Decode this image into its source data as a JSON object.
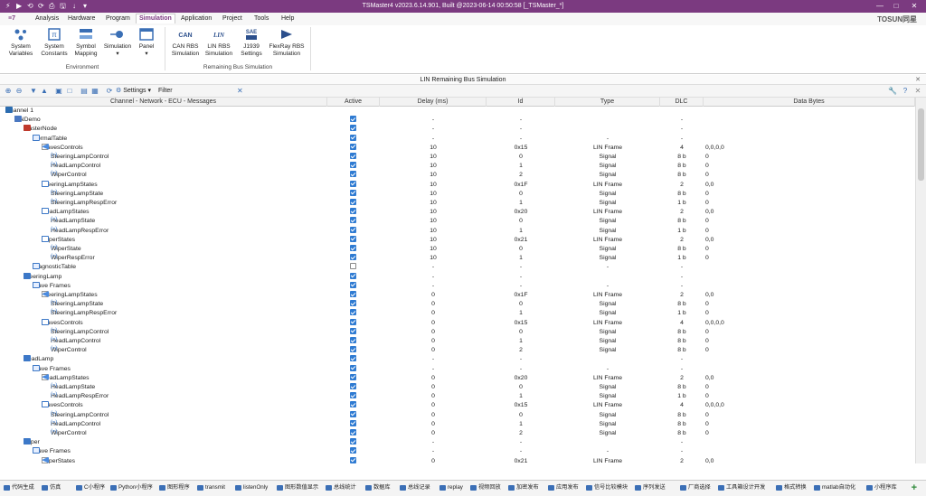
{
  "titlebar": {
    "title": "TSMaster4 v2023.6.14.901, Built @2023-06-14 00:50:58 [_TSMaster_*]",
    "min": "—",
    "max": "□",
    "close": "✕",
    "qa": [
      "⚡",
      "▶",
      "⟲",
      "⟳",
      "⎙",
      "🖫",
      "↓",
      "▾"
    ]
  },
  "menu": {
    "logo": "≡7",
    "items": [
      "Analysis",
      "Hardware",
      "Program",
      "Simulation",
      "Application",
      "Project",
      "Tools",
      "Help"
    ],
    "active": "Simulation",
    "brand": "TOSUN同星"
  },
  "ribbon": {
    "buttons": [
      {
        "label": "System\nVariables",
        "icon": "system-variables-icon"
      },
      {
        "label": "System\nConstants",
        "icon": "system-constants-icon"
      },
      {
        "label": "Symbol\nMapping",
        "icon": "symbol-mapping-icon"
      },
      {
        "label": "Simulation\n▾",
        "icon": "simulation-icon"
      },
      {
        "label": "Panel\n▾",
        "icon": "panel-icon"
      },
      {
        "label": "CAN RBS\nSimulation",
        "icon": "can-rbs-icon",
        "badge": "CAN"
      },
      {
        "label": "LIN RBS\nSimulation",
        "icon": "lin-rbs-icon",
        "badge": "LIN"
      },
      {
        "label": "J1939\nSettings",
        "icon": "j1939-icon",
        "badge": "SAE"
      },
      {
        "label": "FlexRay RBS\nSimulation",
        "icon": "flexray-rbs-icon",
        "badge": "FR"
      }
    ],
    "groups": [
      "Environment",
      "Remaining Bus Simulation"
    ]
  },
  "pane": {
    "title": "LIN Remaining Bus Simulation",
    "close": "✕"
  },
  "toolbar": {
    "settings": "Settings",
    "filter": "Filter",
    "filter_value": "",
    "clear": "✕"
  },
  "columns": [
    "Channel - Network - ECU - Messages",
    "Active",
    "Delay (ms)",
    "Id",
    "Type",
    "DLC",
    "Data Bytes"
  ],
  "rows": [
    {
      "d": 0,
      "exp": "□",
      "ico": "ch",
      "name": "Channel 1",
      "active": null,
      "delay": "",
      "id": "",
      "type": "",
      "dlc": "",
      "data": ""
    },
    {
      "d": 1,
      "exp": "−",
      "ico": "db",
      "name": "LINDemo",
      "active": true,
      "delay": "-",
      "id": "-",
      "type": "",
      "dlc": "-",
      "data": ""
    },
    {
      "d": 2,
      "exp": "−",
      "ico": "node-m",
      "name": "MasterNode",
      "active": true,
      "delay": "-",
      "id": "-",
      "type": "",
      "dlc": "-",
      "data": ""
    },
    {
      "d": 3,
      "exp": "−",
      "ico": "table",
      "name": "NormalTable",
      "active": true,
      "delay": "-",
      "id": "-",
      "type": "-",
      "dlc": "-",
      "data": ""
    },
    {
      "d": 4,
      "exp": "−",
      "ico": "frame",
      "name": "SlavesControls",
      "active": true,
      "delay": "10",
      "id": "0x15",
      "type": "LIN Frame",
      "dlc": "4",
      "data": "0,0,0,0"
    },
    {
      "d": 5,
      "exp": "",
      "ico": "sig",
      "name": "SteeringLampControl",
      "active": true,
      "delay": "10",
      "id": "0",
      "type": "Signal",
      "dlc": "8 b",
      "data": "0"
    },
    {
      "d": 5,
      "exp": "",
      "ico": "sig",
      "name": "HeadLampControl",
      "active": true,
      "delay": "10",
      "id": "1",
      "type": "Signal",
      "dlc": "8 b",
      "data": "0"
    },
    {
      "d": 5,
      "exp": "",
      "ico": "sig",
      "name": "WiperControl",
      "active": true,
      "delay": "10",
      "id": "2",
      "type": "Signal",
      "dlc": "8 b",
      "data": "0"
    },
    {
      "d": 4,
      "exp": "−",
      "ico": "msg",
      "name": "SteeringLampStates",
      "active": true,
      "delay": "10",
      "id": "0x1F",
      "type": "LIN Frame",
      "dlc": "2",
      "data": "0,0"
    },
    {
      "d": 5,
      "exp": "",
      "ico": "sig",
      "name": "SteeringLampState",
      "active": true,
      "delay": "10",
      "id": "0",
      "type": "Signal",
      "dlc": "8 b",
      "data": "0"
    },
    {
      "d": 5,
      "exp": "",
      "ico": "sig",
      "name": "SteeringLampRespError",
      "active": true,
      "delay": "10",
      "id": "1",
      "type": "Signal",
      "dlc": "1 b",
      "data": "0"
    },
    {
      "d": 4,
      "exp": "−",
      "ico": "msg",
      "name": "HeadLampStates",
      "active": true,
      "delay": "10",
      "id": "0x20",
      "type": "LIN Frame",
      "dlc": "2",
      "data": "0,0"
    },
    {
      "d": 5,
      "exp": "",
      "ico": "sig",
      "name": "HeadLampState",
      "active": true,
      "delay": "10",
      "id": "0",
      "type": "Signal",
      "dlc": "8 b",
      "data": "0"
    },
    {
      "d": 5,
      "exp": "",
      "ico": "sig",
      "name": "HeadLampRespError",
      "active": true,
      "delay": "10",
      "id": "1",
      "type": "Signal",
      "dlc": "1 b",
      "data": "0"
    },
    {
      "d": 4,
      "exp": "−",
      "ico": "msg",
      "name": "WiperStates",
      "active": true,
      "delay": "10",
      "id": "0x21",
      "type": "LIN Frame",
      "dlc": "2",
      "data": "0,0"
    },
    {
      "d": 5,
      "exp": "",
      "ico": "sig",
      "name": "WiperState",
      "active": true,
      "delay": "10",
      "id": "0",
      "type": "Signal",
      "dlc": "8 b",
      "data": "0"
    },
    {
      "d": 5,
      "exp": "",
      "ico": "sig",
      "name": "WiperRespError",
      "active": true,
      "delay": "10",
      "id": "1",
      "type": "Signal",
      "dlc": "1 b",
      "data": "0"
    },
    {
      "d": 3,
      "exp": "+",
      "ico": "table",
      "name": "DiagnosticTable",
      "active": false,
      "delay": "-",
      "id": "-",
      "type": "-",
      "dlc": "-",
      "data": ""
    },
    {
      "d": 2,
      "exp": "−",
      "ico": "node-s",
      "name": "SteeringLamp",
      "active": true,
      "delay": "-",
      "id": "-",
      "type": "",
      "dlc": "-",
      "data": ""
    },
    {
      "d": 3,
      "exp": "−",
      "ico": "table",
      "name": "Slave Frames",
      "active": true,
      "delay": "-",
      "id": "-",
      "type": "-",
      "dlc": "-",
      "data": ""
    },
    {
      "d": 4,
      "exp": "−",
      "ico": "frame",
      "name": "SteeringLampStates",
      "active": true,
      "delay": "0",
      "id": "0x1F",
      "type": "LIN Frame",
      "dlc": "2",
      "data": "0,0"
    },
    {
      "d": 5,
      "exp": "",
      "ico": "sig",
      "name": "SteeringLampState",
      "active": true,
      "delay": "0",
      "id": "0",
      "type": "Signal",
      "dlc": "8 b",
      "data": "0"
    },
    {
      "d": 5,
      "exp": "",
      "ico": "sig",
      "name": "SteeringLampRespError",
      "active": true,
      "delay": "0",
      "id": "1",
      "type": "Signal",
      "dlc": "1 b",
      "data": "0"
    },
    {
      "d": 4,
      "exp": "−",
      "ico": "msg",
      "name": "SlavesControls",
      "active": true,
      "delay": "0",
      "id": "0x15",
      "type": "LIN Frame",
      "dlc": "4",
      "data": "0,0,0,0"
    },
    {
      "d": 5,
      "exp": "",
      "ico": "sig",
      "name": "SteeringLampControl",
      "active": true,
      "delay": "0",
      "id": "0",
      "type": "Signal",
      "dlc": "8 b",
      "data": "0"
    },
    {
      "d": 5,
      "exp": "",
      "ico": "sig",
      "name": "HeadLampControl",
      "active": true,
      "delay": "0",
      "id": "1",
      "type": "Signal",
      "dlc": "8 b",
      "data": "0"
    },
    {
      "d": 5,
      "exp": "",
      "ico": "sig",
      "name": "WiperControl",
      "active": true,
      "delay": "0",
      "id": "2",
      "type": "Signal",
      "dlc": "8 b",
      "data": "0"
    },
    {
      "d": 2,
      "exp": "−",
      "ico": "node-s",
      "name": "HeadLamp",
      "active": true,
      "delay": "-",
      "id": "-",
      "type": "",
      "dlc": "-",
      "data": ""
    },
    {
      "d": 3,
      "exp": "−",
      "ico": "table",
      "name": "Slave Frames",
      "active": true,
      "delay": "-",
      "id": "-",
      "type": "-",
      "dlc": "-",
      "data": ""
    },
    {
      "d": 4,
      "exp": "−",
      "ico": "frame",
      "name": "HeadLampStates",
      "active": true,
      "delay": "0",
      "id": "0x20",
      "type": "LIN Frame",
      "dlc": "2",
      "data": "0,0"
    },
    {
      "d": 5,
      "exp": "",
      "ico": "sig",
      "name": "HeadLampState",
      "active": true,
      "delay": "0",
      "id": "0",
      "type": "Signal",
      "dlc": "8 b",
      "data": "0"
    },
    {
      "d": 5,
      "exp": "",
      "ico": "sig",
      "name": "HeadLampRespError",
      "active": true,
      "delay": "0",
      "id": "1",
      "type": "Signal",
      "dlc": "1 b",
      "data": "0"
    },
    {
      "d": 4,
      "exp": "−",
      "ico": "msg",
      "name": "SlavesControls",
      "active": true,
      "delay": "0",
      "id": "0x15",
      "type": "LIN Frame",
      "dlc": "4",
      "data": "0,0,0,0"
    },
    {
      "d": 5,
      "exp": "",
      "ico": "sig",
      "name": "SteeringLampControl",
      "active": true,
      "delay": "0",
      "id": "0",
      "type": "Signal",
      "dlc": "8 b",
      "data": "0"
    },
    {
      "d": 5,
      "exp": "",
      "ico": "sig",
      "name": "HeadLampControl",
      "active": true,
      "delay": "0",
      "id": "1",
      "type": "Signal",
      "dlc": "8 b",
      "data": "0"
    },
    {
      "d": 5,
      "exp": "",
      "ico": "sig",
      "name": "WiperControl",
      "active": true,
      "delay": "0",
      "id": "2",
      "type": "Signal",
      "dlc": "8 b",
      "data": "0"
    },
    {
      "d": 2,
      "exp": "−",
      "ico": "node-s",
      "name": "Wiper",
      "active": true,
      "delay": "-",
      "id": "-",
      "type": "",
      "dlc": "-",
      "data": ""
    },
    {
      "d": 3,
      "exp": "−",
      "ico": "table",
      "name": "Slave Frames",
      "active": true,
      "delay": "-",
      "id": "-",
      "type": "-",
      "dlc": "-",
      "data": ""
    },
    {
      "d": 4,
      "exp": "−",
      "ico": "frame",
      "name": "WiperStates",
      "active": true,
      "delay": "0",
      "id": "0x21",
      "type": "LIN Frame",
      "dlc": "2",
      "data": "0,0"
    }
  ],
  "taskbar": [
    "代码生成",
    "仿真",
    "C小程序",
    "Python小程序",
    "图形程序",
    "transmit",
    "listenOnly",
    "图形数值显示",
    "总线统计",
    "数据库",
    "总线记录",
    "replay",
    "视频回放",
    "加密发布",
    "应用发布",
    "信号比较模块",
    "序列发送",
    "厂商选择",
    "工具箱设计开发",
    "格式转换",
    "matlab自动化",
    "小程序库"
  ],
  "taskbar_add": "+"
}
